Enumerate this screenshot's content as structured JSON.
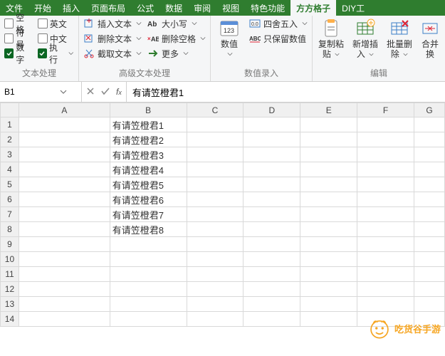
{
  "tabs": {
    "items": [
      "文件",
      "开始",
      "插入",
      "页面布局",
      "公式",
      "数据",
      "审阅",
      "视图",
      "特色功能",
      "方方格子",
      "DIY工"
    ],
    "active": "方方格子"
  },
  "ribbon": {
    "group1": {
      "title": "文本处理",
      "checks": {
        "space": "空格",
        "english": "英文",
        "symbol": "符号",
        "chinese": "中文",
        "number": "数字",
        "execute": "执行"
      }
    },
    "group2": {
      "title": "高级文本处理",
      "col1": {
        "insert": "插入文本",
        "delete": "删除文本",
        "cut": "截取文本"
      },
      "col2": {
        "case": "大小写",
        "delspace": "删除空格",
        "more": "更多"
      }
    },
    "group3": {
      "title": "数值录入",
      "big": "数值",
      "col": {
        "round": "四舍五入",
        "keepnum": "只保留数值"
      }
    },
    "group4": {
      "title": "编辑",
      "b1": {
        "l1": "复制粘",
        "l2": "贴"
      },
      "b2": {
        "l1": "新增插",
        "l2": "入"
      },
      "b3": {
        "l1": "批量删",
        "l2": "除"
      },
      "b4": {
        "l1": "合并",
        "l2": "换"
      }
    }
  },
  "namebox": {
    "value": "B1"
  },
  "formula": {
    "value": "有请笠橙君1"
  },
  "grid": {
    "columns": [
      "A",
      "B",
      "C",
      "D",
      "E",
      "F",
      "G"
    ],
    "rows": [
      {
        "n": 1,
        "B": "有请笠橙君1"
      },
      {
        "n": 2,
        "B": "有请笠橙君2"
      },
      {
        "n": 3,
        "B": "有请笠橙君3"
      },
      {
        "n": 4,
        "B": "有请笠橙君4"
      },
      {
        "n": 5,
        "B": "有请笠橙君5"
      },
      {
        "n": 6,
        "B": "有请笠橙君6"
      },
      {
        "n": 7,
        "B": "有请笠橙君7"
      },
      {
        "n": 8,
        "B": "有请笠橙君8"
      },
      {
        "n": 9
      },
      {
        "n": 10
      },
      {
        "n": 11
      },
      {
        "n": 12
      },
      {
        "n": 13
      },
      {
        "n": 14
      }
    ]
  },
  "watermark": "吃货谷手游"
}
